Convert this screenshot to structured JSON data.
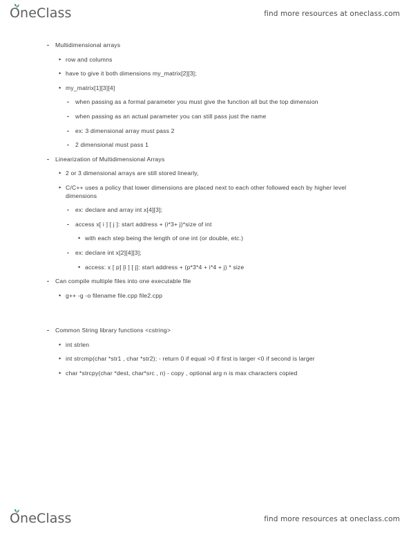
{
  "header": {
    "brand": "OneClass",
    "brand_icon": "leaf-sprout-icon",
    "tagline": "find more resources at oneclass.com",
    "leaf_color": "#2e8b57"
  },
  "footer": {
    "brand": "OneClass",
    "brand_icon": "leaf-sprout-icon",
    "tagline": "find more resources at oneclass.com"
  },
  "glyphs": {
    "dash": "-",
    "dot": "•"
  },
  "notes": [
    {
      "level": 1,
      "marker": "dash",
      "text": "Multidimensional arrays"
    },
    {
      "level": 2,
      "marker": "dot",
      "text": "row and columns"
    },
    {
      "level": 2,
      "marker": "dot",
      "text": "have to give it both dimensions my_matrix[2][3];"
    },
    {
      "level": 2,
      "marker": "dot",
      "text": "my_matrix[1][3][4]"
    },
    {
      "level": 3,
      "marker": "dash",
      "text": "when passing as a formal parameter you must give the function all but the top dimension"
    },
    {
      "level": 3,
      "marker": "dash",
      "text": "when passing as an actual parameter you can still pass just the name"
    },
    {
      "level": 3,
      "marker": "dash",
      "text": "ex: 3 dimensional array must pass 2"
    },
    {
      "level": 3,
      "marker": "dash",
      "text": "2 dimensional must pass 1"
    },
    {
      "level": 1,
      "marker": "dash",
      "text": "Linearization of Multidimensional Arrays"
    },
    {
      "level": 2,
      "marker": "dot",
      "text": "2 or 3 dimensional arrays are still stored linearly,"
    },
    {
      "level": 2,
      "marker": "dot",
      "text": "C/C++ uses a policy that lower dimensions are placed next to each other followed each by higher level dimensions"
    },
    {
      "level": 3,
      "marker": "dash",
      "text": "ex: declare and array int x[4][3];"
    },
    {
      "level": 3,
      "marker": "dash",
      "text": "access  x[ i ] [ j ]: start address + (i*3+ j)*size of int"
    },
    {
      "level": 4,
      "marker": "dot",
      "text": "with each step being the length of one int (or double, etc.)"
    },
    {
      "level": 3,
      "marker": "dash",
      "text": "ex: declare int x[2][4][3];"
    },
    {
      "level": 4,
      "marker": "dot",
      "text": "access: x [ p] [i ] [ j]: start address + (p*3*4 + i*4 + j) * size"
    },
    {
      "level": 1,
      "marker": "dash",
      "text": "Can compile multiple files into one executable file"
    },
    {
      "level": 2,
      "marker": "dot",
      "text": "g++ -g -o filename file.cpp file2.cpp"
    },
    {
      "level": 0,
      "marker": "gap-lg",
      "text": ""
    },
    {
      "level": 1,
      "marker": "dash",
      "text": "Common String library functions <cstring>"
    },
    {
      "level": 2,
      "marker": "dot",
      "text": "int strlen"
    },
    {
      "level": 2,
      "marker": "dot",
      "text": "int strcmp(char *str1 , char *str2); - return 0 if equal >0 if first is larger <0 if second is larger"
    },
    {
      "level": 2,
      "marker": "dot",
      "text": "char *strcpy(char *dest, char*src , n) - copy , optional arg n is max characters copied"
    }
  ]
}
